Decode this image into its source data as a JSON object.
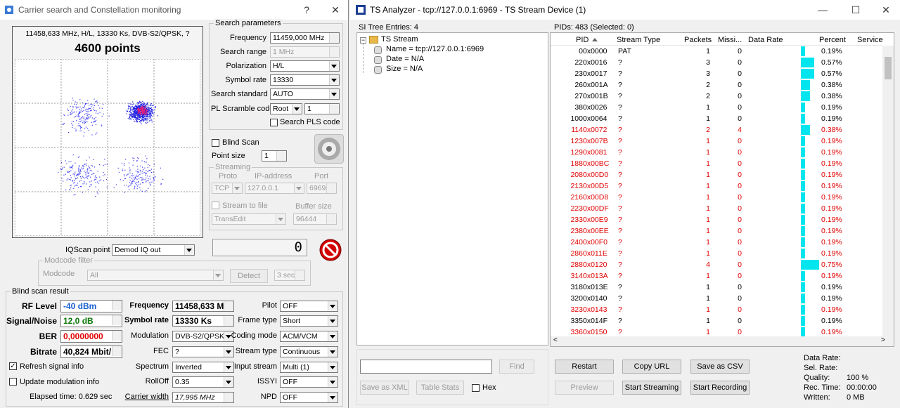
{
  "left_window": {
    "title": "Carrier search and Constellation monitoring",
    "help": "?",
    "close": "✕",
    "info_line": "11458,633 MHz, H/L, 13330 Ks, DVB-S2/QPSK, ?",
    "points": "4600 points",
    "search_params": {
      "legend": "Search parameters",
      "frequency_label": "Frequency",
      "frequency_value": "11459,000 MHz",
      "range_label": "Search range",
      "range_value": "1 MHz",
      "polarization_label": "Polarization",
      "polarization_value": "H/L",
      "symbol_rate_label": "Symbol rate",
      "symbol_rate_value": "13330",
      "standard_label": "Search standard",
      "standard_value": "AUTO",
      "pl_label": "PL Scramble code",
      "pl_mode": "Root",
      "pl_value": "1",
      "search_pls": "Search PLS code"
    },
    "blind_scan": "Blind Scan",
    "point_size_label": "Point size",
    "point_size_value": "1",
    "streaming": {
      "legend": "Streaming",
      "proto_label": "Proto",
      "ip_label": "IP-address",
      "port_label": "Port",
      "proto_value": "TCP",
      "ip_value": "127.0.0.1",
      "port_value": "6969",
      "to_file": "Stream to file",
      "buffer_label": "Buffer size",
      "file_value": "TransEdit",
      "buffer_value": "96444"
    },
    "counter": "0",
    "iqscan_label": "IQScan point",
    "iqscan_value": "Demod IQ out",
    "modcode": {
      "legend": "Modcode filter",
      "label": "Modcode",
      "value": "All",
      "detect": "Detect",
      "sec": "3 sec"
    },
    "result": {
      "legend": "Blind scan result",
      "rf_label": "RF Level",
      "rf_value": "-40 dBm",
      "sn_label": "Signal/Noise",
      "sn_value": "12,0 dB",
      "ber_label": "BER",
      "ber_value": "0,0000000",
      "bitrate_label": "Bitrate",
      "bitrate_value": "40,824 Mbit/",
      "freq_label": "Frequency",
      "freq_value": "11458,633 MH",
      "sr_label": "Symbol rate",
      "sr_value": "13330 Ks",
      "mod_label": "Modulation",
      "mod_value": "DVB-S2/QPSK",
      "fec_label": "FEC",
      "fec_value": "?",
      "spec_label": "Spectrum",
      "spec_value": "Inverted",
      "roll_label": "RollOff",
      "roll_value": "0.35",
      "cw_label": "Carrier width",
      "cw_value": "17,995 MHz",
      "pilot_label": "Pilot",
      "pilot_value": "OFF",
      "frame_label": "Frame type",
      "frame_value": "Short",
      "coding_label": "Coding mode",
      "coding_value": "ACM/VCM",
      "stype_label": "Stream type",
      "stype_value": "Continuous",
      "input_label": "Input stream",
      "input_value": "Multi (1)",
      "issyi_label": "ISSYI",
      "issyi_value": "OFF",
      "npd_label": "NPD",
      "npd_value": "OFF",
      "refresh": "Refresh signal info",
      "update_mod": "Update modulation info",
      "elapsed": "Elapsed time: 0.629 sec"
    }
  },
  "right_window": {
    "title": "TS Analyzer - tcp://127.0.0.1:6969 - TS Stream Device (1)",
    "si_entries": "SI Tree Entries: 4",
    "pids_info": "PIDs: 483   (Selected: 0)",
    "tree": {
      "root": "TS Stream",
      "items": [
        "Name = tcp://127.0.0.1:6969",
        "Date = N/A",
        "Size = N/A"
      ]
    },
    "columns": [
      "PID",
      "Stream Type",
      "Packets",
      "Missi...",
      "Data Rate",
      "Percent",
      "Service"
    ],
    "rows": [
      {
        "pid": "0",
        "hex": "0x0000",
        "type": "PAT",
        "packets": "1",
        "missing": "0",
        "percent": "0.19%",
        "pct": 0.19,
        "red": false
      },
      {
        "pid": "22",
        "hex": "0x0016",
        "type": "?",
        "packets": "3",
        "missing": "0",
        "percent": "0.57%",
        "pct": 0.57,
        "red": false
      },
      {
        "pid": "23",
        "hex": "0x0017",
        "type": "?",
        "packets": "3",
        "missing": "0",
        "percent": "0.57%",
        "pct": 0.57,
        "red": false
      },
      {
        "pid": "26",
        "hex": "0x001A",
        "type": "?",
        "packets": "2",
        "missing": "0",
        "percent": "0.38%",
        "pct": 0.38,
        "red": false
      },
      {
        "pid": "27",
        "hex": "0x001B",
        "type": "?",
        "packets": "2",
        "missing": "0",
        "percent": "0.38%",
        "pct": 0.38,
        "red": false
      },
      {
        "pid": "38",
        "hex": "0x0026",
        "type": "?",
        "packets": "1",
        "missing": "0",
        "percent": "0.19%",
        "pct": 0.19,
        "red": false
      },
      {
        "pid": "100",
        "hex": "0x0064",
        "type": "?",
        "packets": "1",
        "missing": "0",
        "percent": "0.19%",
        "pct": 0.19,
        "red": false
      },
      {
        "pid": "114",
        "hex": "0x0072",
        "type": "?",
        "packets": "2",
        "missing": "4",
        "percent": "0.38%",
        "pct": 0.38,
        "red": true
      },
      {
        "pid": "123",
        "hex": "0x007B",
        "type": "?",
        "packets": "1",
        "missing": "0",
        "percent": "0.19%",
        "pct": 0.19,
        "red": true
      },
      {
        "pid": "129",
        "hex": "0x0081",
        "type": "?",
        "packets": "1",
        "missing": "0",
        "percent": "0.19%",
        "pct": 0.19,
        "red": true
      },
      {
        "pid": "188",
        "hex": "0x00BC",
        "type": "?",
        "packets": "1",
        "missing": "0",
        "percent": "0.19%",
        "pct": 0.19,
        "red": true
      },
      {
        "pid": "208",
        "hex": "0x00D0",
        "type": "?",
        "packets": "1",
        "missing": "0",
        "percent": "0.19%",
        "pct": 0.19,
        "red": true
      },
      {
        "pid": "213",
        "hex": "0x00D5",
        "type": "?",
        "packets": "1",
        "missing": "0",
        "percent": "0.19%",
        "pct": 0.19,
        "red": true
      },
      {
        "pid": "216",
        "hex": "0x00D8",
        "type": "?",
        "packets": "1",
        "missing": "0",
        "percent": "0.19%",
        "pct": 0.19,
        "red": true
      },
      {
        "pid": "223",
        "hex": "0x00DF",
        "type": "?",
        "packets": "1",
        "missing": "0",
        "percent": "0.19%",
        "pct": 0.19,
        "red": true
      },
      {
        "pid": "233",
        "hex": "0x00E9",
        "type": "?",
        "packets": "1",
        "missing": "0",
        "percent": "0.19%",
        "pct": 0.19,
        "red": true
      },
      {
        "pid": "238",
        "hex": "0x00EE",
        "type": "?",
        "packets": "1",
        "missing": "0",
        "percent": "0.19%",
        "pct": 0.19,
        "red": true
      },
      {
        "pid": "240",
        "hex": "0x00F0",
        "type": "?",
        "packets": "1",
        "missing": "0",
        "percent": "0.19%",
        "pct": 0.19,
        "red": true
      },
      {
        "pid": "286",
        "hex": "0x011E",
        "type": "?",
        "packets": "1",
        "missing": "0",
        "percent": "0.19%",
        "pct": 0.19,
        "red": true
      },
      {
        "pid": "288",
        "hex": "0x0120",
        "type": "?",
        "packets": "4",
        "missing": "0",
        "percent": "0.75%",
        "pct": 0.75,
        "red": true
      },
      {
        "pid": "314",
        "hex": "0x013A",
        "type": "?",
        "packets": "1",
        "missing": "0",
        "percent": "0.19%",
        "pct": 0.19,
        "red": true
      },
      {
        "pid": "318",
        "hex": "0x013E",
        "type": "?",
        "packets": "1",
        "missing": "0",
        "percent": "0.19%",
        "pct": 0.19,
        "red": false
      },
      {
        "pid": "320",
        "hex": "0x0140",
        "type": "?",
        "packets": "1",
        "missing": "0",
        "percent": "0.19%",
        "pct": 0.19,
        "red": false
      },
      {
        "pid": "323",
        "hex": "0x0143",
        "type": "?",
        "packets": "1",
        "missing": "0",
        "percent": "0.19%",
        "pct": 0.19,
        "red": true
      },
      {
        "pid": "335",
        "hex": "0x014F",
        "type": "?",
        "packets": "1",
        "missing": "0",
        "percent": "0.19%",
        "pct": 0.19,
        "red": false
      },
      {
        "pid": "336",
        "hex": "0x0150",
        "type": "?",
        "packets": "1",
        "missing": "0",
        "percent": "0.19%",
        "pct": 0.19,
        "red": true
      }
    ],
    "find": "Find",
    "save_xml": "Save as XML",
    "table_stats": "Table Stats",
    "hex": "Hex",
    "restart": "Restart",
    "copy_url": "Copy URL",
    "save_csv": "Save as CSV",
    "preview": "Preview",
    "start_streaming": "Start Streaming",
    "start_recording": "Start Recording",
    "stats": {
      "data_rate": "Data Rate:",
      "sel_rate": "Sel. Rate:",
      "quality": "Quality:",
      "quality_value": "100 %",
      "rec_time": "Rec. Time:",
      "rec_time_value": "00:00:00",
      "written": "Written:",
      "written_value": "0 MB"
    }
  },
  "colors": {
    "accent_cyan": "#00e5ee",
    "red": "#e00000",
    "blue_value": "#1a5fd0",
    "green_value": "#0a7a0a"
  }
}
